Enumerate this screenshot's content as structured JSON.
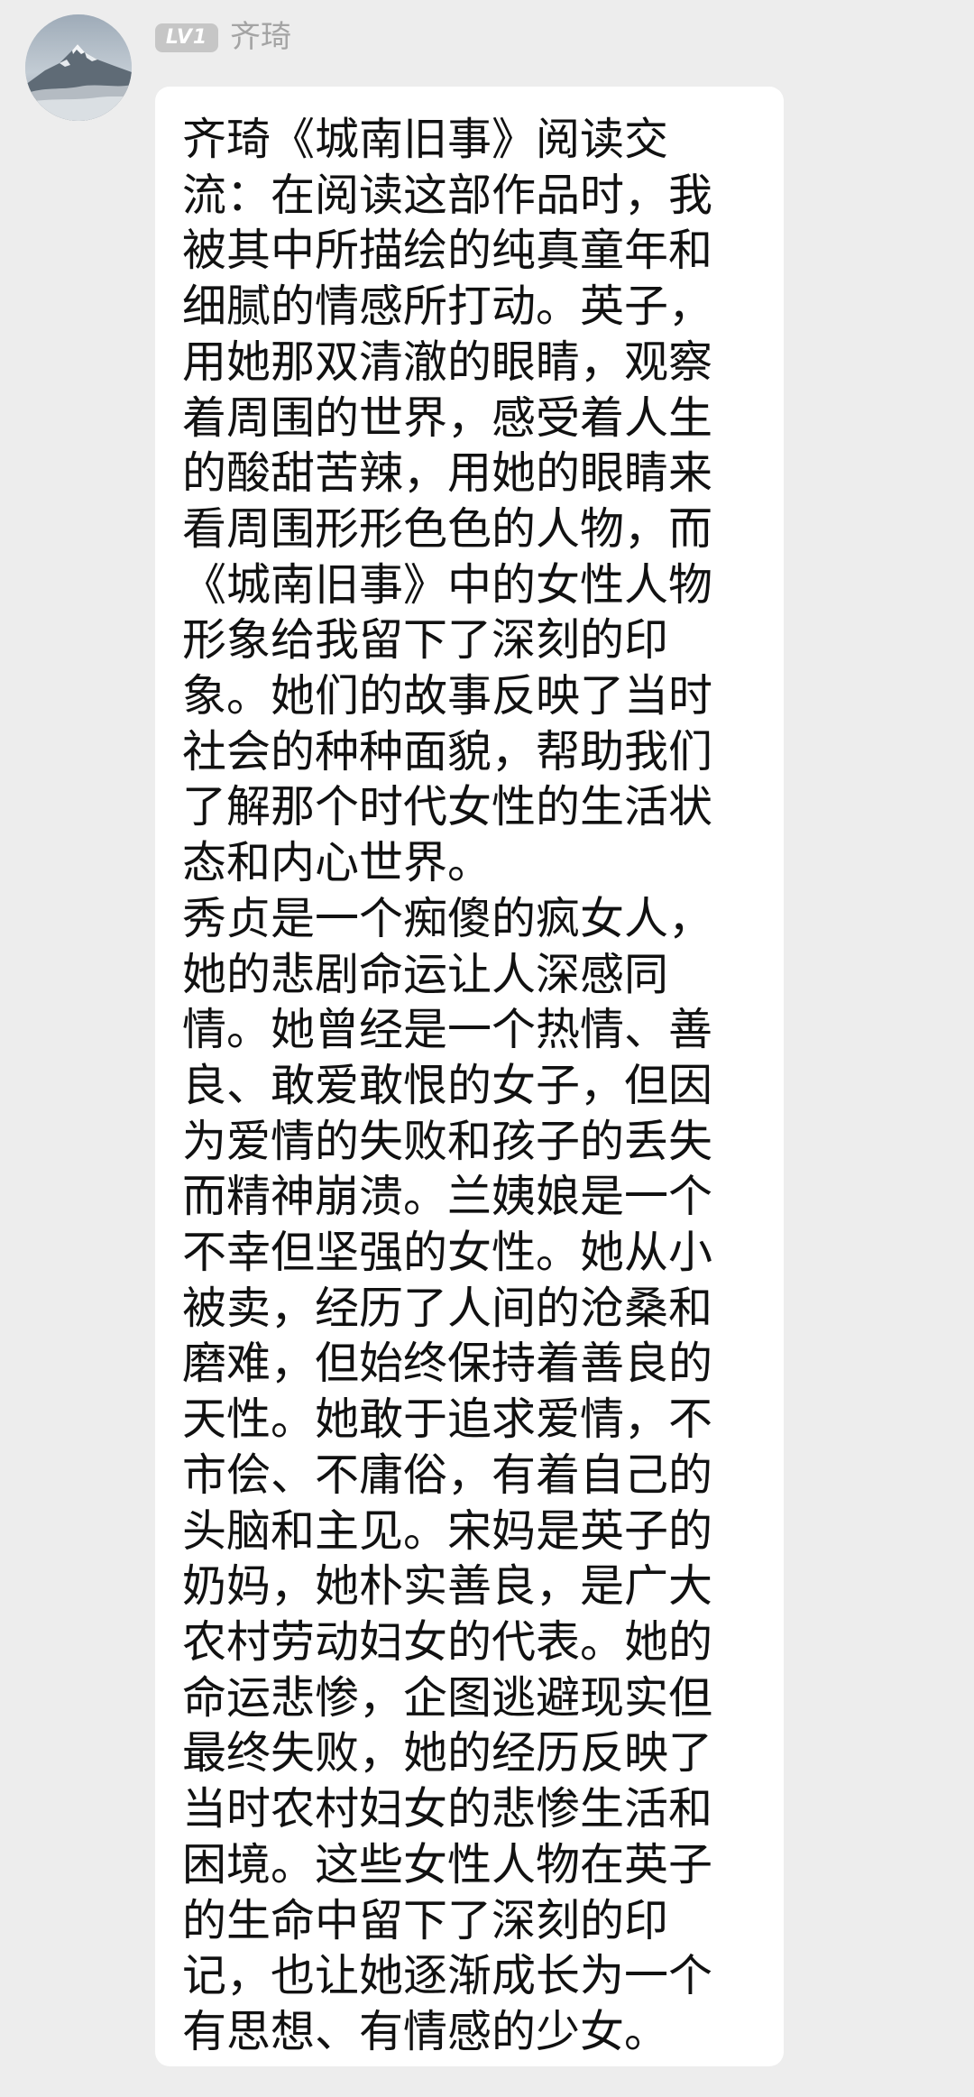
{
  "sender": {
    "avatar_icon": "snowy-mountain-avatar-icon",
    "level_badge": "LV1",
    "name": "齐琦"
  },
  "message": {
    "text": "齐琦《城南旧事》阅读交流：在阅读这部作品时，我被其中所描绘的纯真童年和细腻的情感所打动。英子，用她那双清澈的眼睛，观察着周围的世界，感受着人生的酸甜苦辣，用她的眼睛来看周围形形色色的人物，而《城南旧事》中的女性人物形象给我留下了深刻的印象。她们的故事反映了当时社会的种种面貌，帮助我们了解那个时代女性的生活状态和内心世界。\n秀贞是一个痴傻的疯女人，她的悲剧命运让人深感同情。她曾经是一个热情、善良、敢爱敢恨的女子，但因为爱情的失败和孩子的丢失而精神崩溃。兰姨娘是一个不幸但坚强的女性。她从小被卖，经历了人间的沧桑和磨难，但始终保持着善良的天性。她敢于追求爱情，不市侩、不庸俗，有着自己的头脑和主见。宋妈是英子的奶妈，她朴实善良，是广大农村劳动妇女的代表。她的命运悲惨，企图逃避现实但最终失败，她的经历反映了当时农村妇女的悲惨生活和困境。这些女性人物在英子的生命中留下了深刻的印记，也让她逐渐成长为一个有思想、有情感的少女。"
  },
  "colors": {
    "page_background": "#ededed",
    "bubble_background": "#ffffff",
    "name_text": "#a4a4a4",
    "badge_background": "#c6c6c6"
  }
}
